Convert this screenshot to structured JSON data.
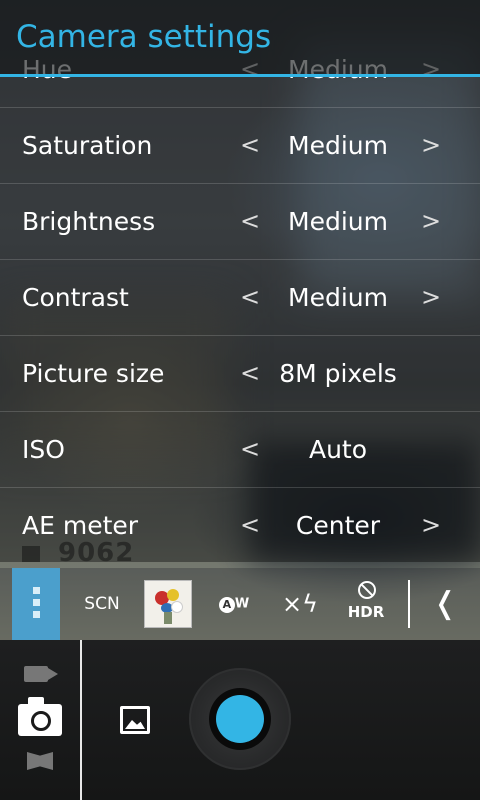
{
  "title": "Camera settings",
  "settings": [
    {
      "label": "Hue",
      "value": "Medium",
      "has_right_arrow": true
    },
    {
      "label": "Saturation",
      "value": "Medium",
      "has_right_arrow": true
    },
    {
      "label": "Brightness",
      "value": "Medium",
      "has_right_arrow": true
    },
    {
      "label": "Contrast",
      "value": "Medium",
      "has_right_arrow": true
    },
    {
      "label": "Picture size",
      "value": "8M pixels",
      "has_right_arrow": false
    },
    {
      "label": "ISO",
      "value": "Auto",
      "has_right_arrow": false
    },
    {
      "label": "AE meter",
      "value": "Center",
      "has_right_arrow": true
    }
  ],
  "arrows": {
    "left": "<",
    "right": ">"
  },
  "preview_watermark": "9062",
  "quick_bar": {
    "scene_label": "SCN",
    "awb_badge": "A",
    "awb_suffix": "W",
    "flash_glyph": "×ϟ",
    "hdr_label": "HDR",
    "collapse_glyph": "❬"
  },
  "accent_color": "#33b5e5"
}
